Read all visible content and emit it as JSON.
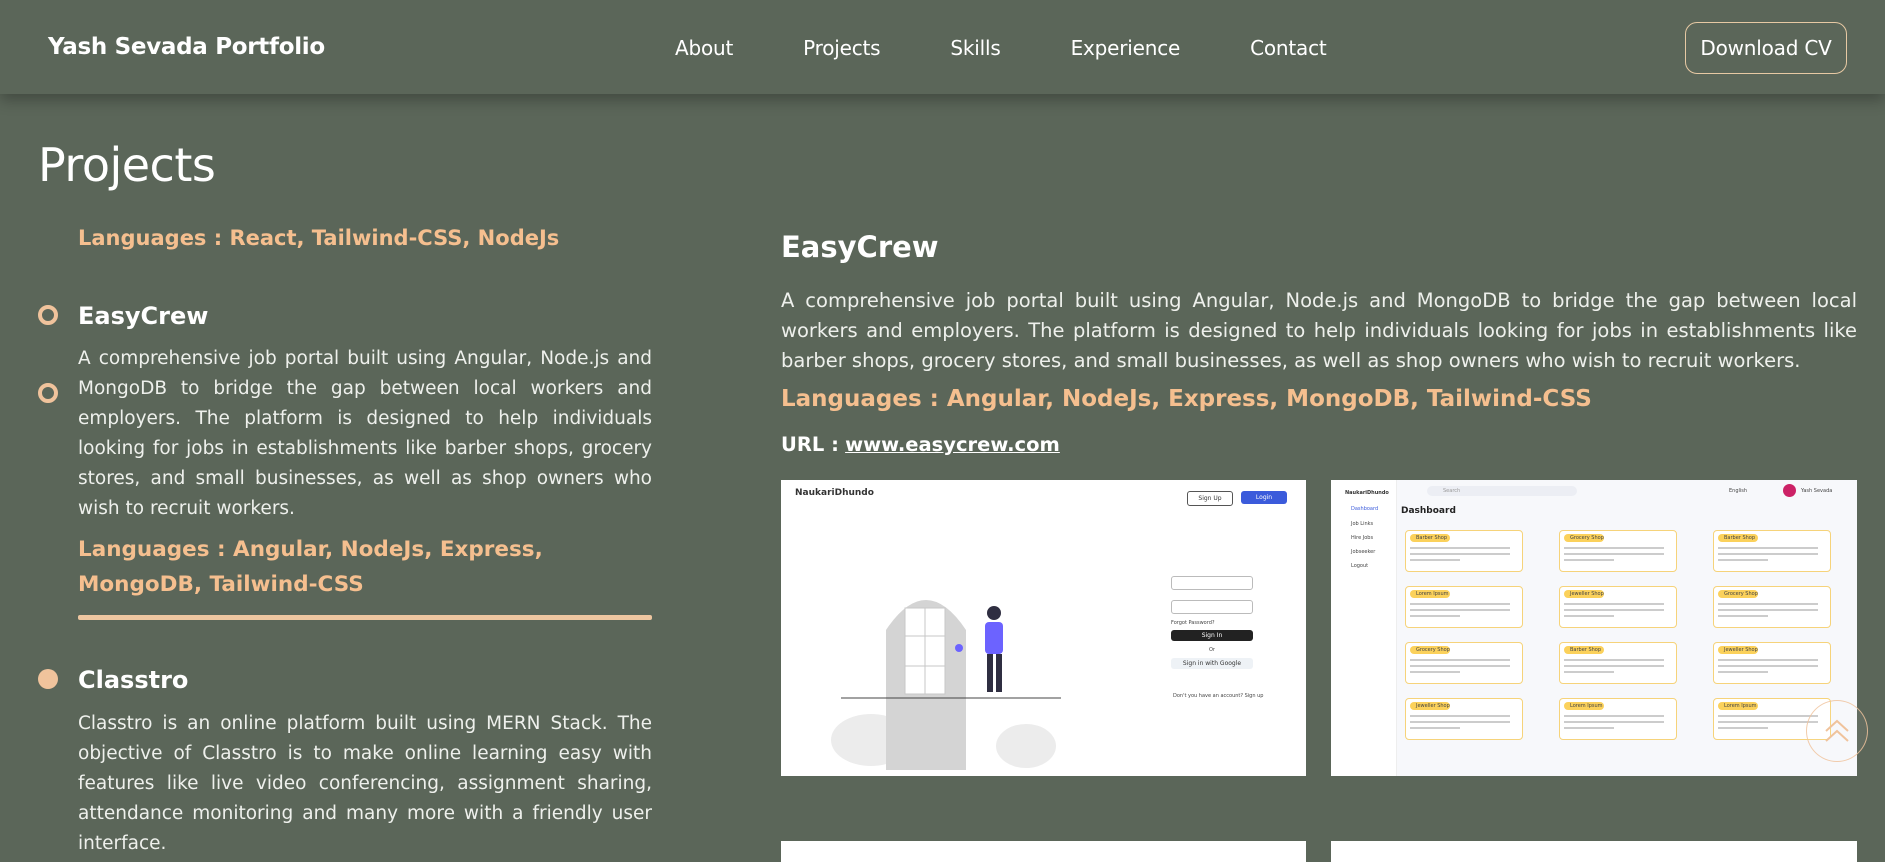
{
  "header": {
    "brand": "Yash Sevada Portfolio",
    "nav": [
      "About",
      "Projects",
      "Skills",
      "Experience",
      "Contact"
    ],
    "cv_button": "Download CV"
  },
  "section": {
    "title": "Projects"
  },
  "timeline": {
    "previous_languages": "Languages : React, Tailwind-CSS, NodeJs",
    "items": [
      {
        "title": "EasyCrew",
        "description": "A comprehensive job portal built using Angular, Node.js and MongoDB to bridge the gap between local workers and employers. The platform is designed to help individuals looking for jobs in establishments like barber shops, grocery stores, and small businesses, as well as shop owners who wish to recruit workers.",
        "languages": "Languages : Angular, NodeJs, Express, MongoDB, Tailwind-CSS"
      },
      {
        "title": "Classtro",
        "description": "Classtro is an online platform built using MERN Stack. The objective of Classtro is to make online learning easy with features like live video conferencing, assignment sharing, attendance monitoring and many more with a friendly user interface."
      }
    ]
  },
  "detail": {
    "title": "EasyCrew",
    "description": "A comprehensive job portal built using Angular, Node.js and MongoDB to bridge the gap between local workers and employers. The platform is designed to help individuals looking for jobs in establishments like barber shops, grocery stores, and small businesses, as well as shop owners who wish to recruit workers.",
    "languages": "Languages : Angular, NodeJs, Express, MongoDB, Tailwind-CSS",
    "url_label": "URL :",
    "url": "www.easycrew.com",
    "screenshots": {
      "login": {
        "logo": "NaukariDhundo",
        "signup": "Sign Up",
        "login": "Login",
        "forgot": "Forgot Password?",
        "signin": "Sign In",
        "or": "Or",
        "google": "Sign in with Google",
        "no_account": "Don't you have an account? Sign up"
      },
      "dashboard": {
        "logo": "NaukariDhundo",
        "heading": "Dashboard",
        "search_placeholder": "Search",
        "user": "Yash Sevada",
        "language": "English",
        "sidebar": [
          "Dashboard",
          "Job Links",
          "Hire Jobs",
          "Jobseeker",
          "Logout"
        ],
        "cards": [
          "Barber Shop",
          "Grocery Shop",
          "Barber Shop",
          "Lorem Ipsum",
          "Jeweller Shop",
          "Grocery Shop",
          "Grocery Shop",
          "Barber Shop",
          "Jeweller Shop",
          "Jeweller Shop",
          "Lorem Ipsum",
          "Lorem Ipsum"
        ]
      }
    }
  },
  "colors": {
    "background": "#5b6659",
    "accent": "#f5bf8f",
    "text": "#ffffff"
  },
  "icons": {
    "scroll_top": "double-chevron-up-icon"
  }
}
